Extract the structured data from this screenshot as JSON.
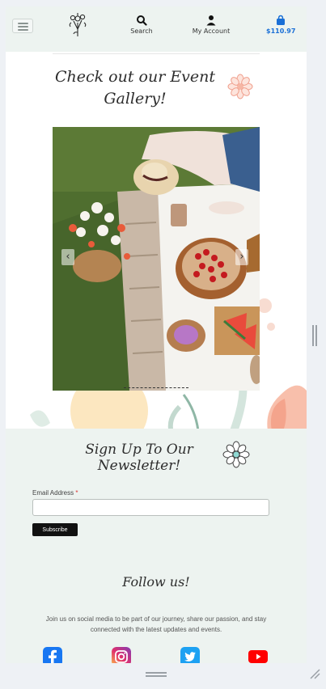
{
  "header": {
    "menu_icon": "hamburger-icon",
    "logo_icon": "flower-bouquet-logo",
    "search_label": "Search",
    "account_label": "My Account",
    "cart_total": "$110.97",
    "accent_color": "#1a6fd6"
  },
  "gallery": {
    "title_line1": "Check out our Event",
    "title_line2": "Gallery!",
    "prev_icon": "chevron-left-icon",
    "next_icon": "chevron-right-icon",
    "arrow_prev": "‹",
    "arrow_next": "›"
  },
  "newsletter": {
    "title": "Sign Up To Our Newsletter!",
    "email_label": "Email Address",
    "required_mark": "*",
    "email_value": "",
    "subscribe_label": "Subscribe"
  },
  "follow": {
    "title": "Follow us!",
    "text": "Join us on social media to be part of our journey, share our passion, and stay connected with the latest updates and events.",
    "icons": [
      "facebook-icon",
      "instagram-icon",
      "twitter-icon",
      "youtube-icon"
    ]
  }
}
